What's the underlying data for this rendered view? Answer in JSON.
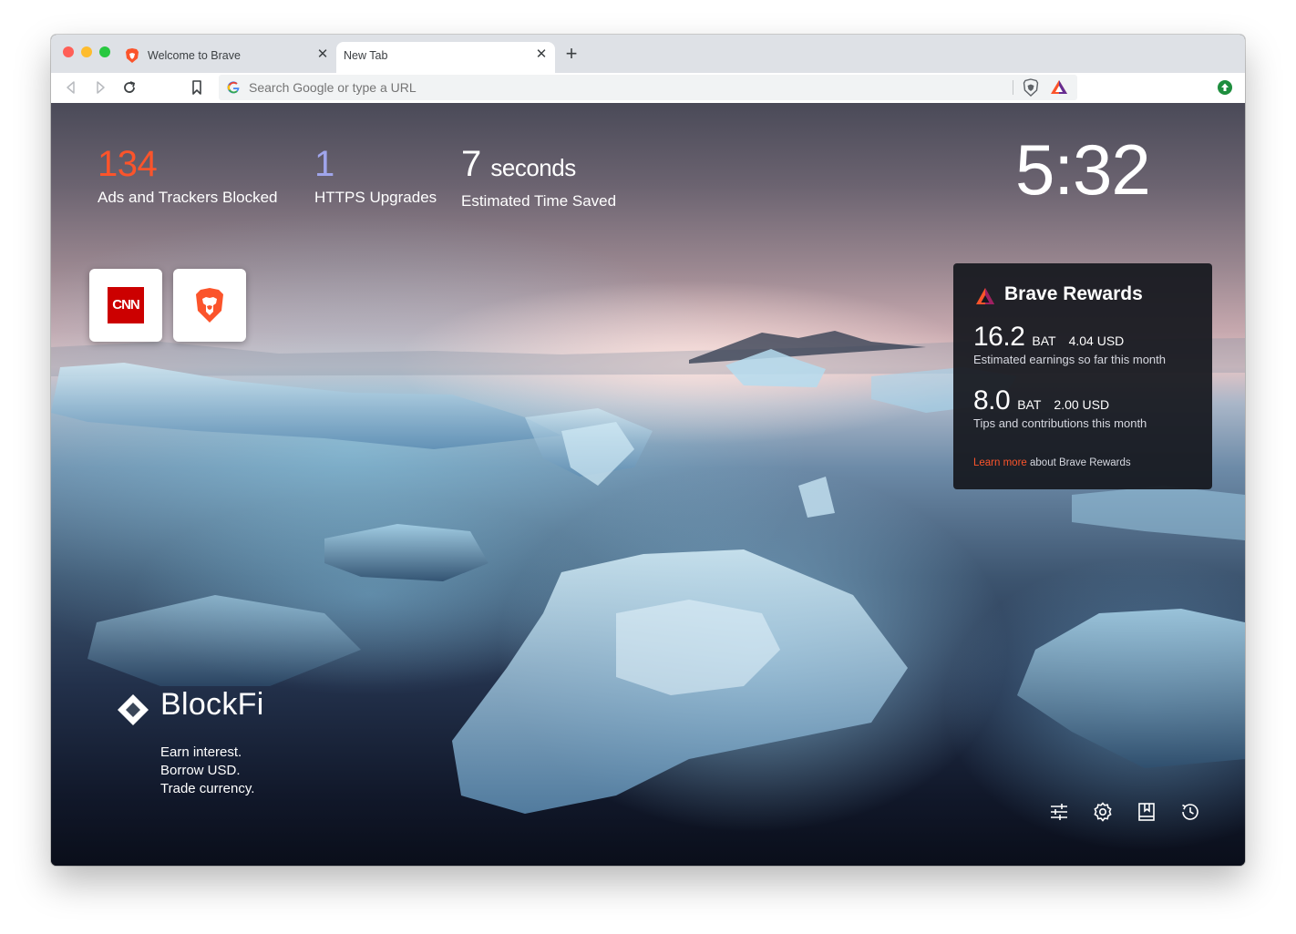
{
  "tabs": [
    {
      "title": "Welcome to Brave",
      "active": false
    },
    {
      "title": "New Tab",
      "active": true
    }
  ],
  "toolbar": {
    "omnibox_placeholder": "Search Google or type a URL"
  },
  "stats": {
    "ads_blocked": {
      "value": "134",
      "label": "Ads and Trackers Blocked"
    },
    "https_upgrades": {
      "value": "1",
      "label": "HTTPS Upgrades"
    },
    "time_saved": {
      "value": "7",
      "unit": "seconds",
      "label": "Estimated Time Saved"
    }
  },
  "clock": "5:32",
  "top_sites": [
    {
      "name": "CNN",
      "logo_text": "CNN"
    },
    {
      "name": "Brave",
      "logo_text": ""
    }
  ],
  "rewards": {
    "title": "Brave Rewards",
    "earnings": {
      "amount": "16.2",
      "currency": "BAT",
      "usd": "4.04 USD",
      "desc": "Estimated earnings so far this month"
    },
    "tips": {
      "amount": "8.0",
      "currency": "BAT",
      "usd": "2.00 USD",
      "desc": "Tips and contributions this month"
    },
    "learn_more": "Learn more",
    "learn_more_suffix": " about Brave Rewards"
  },
  "sponsor": {
    "name": "BlockFi",
    "line1": "Earn interest.",
    "line2": "Borrow USD.",
    "line3": "Trade currency."
  },
  "colors": {
    "brave_orange": "#fb542b",
    "https_purple": "#a0a5eb"
  },
  "icons": [
    "back-icon",
    "forward-icon",
    "reload-icon",
    "bookmark-icon",
    "google-icon",
    "brave-shield-icon",
    "rewards-triangle-icon",
    "extension-update-icon",
    "customize-icon",
    "settings-icon",
    "bookmarks-icon",
    "history-icon"
  ]
}
